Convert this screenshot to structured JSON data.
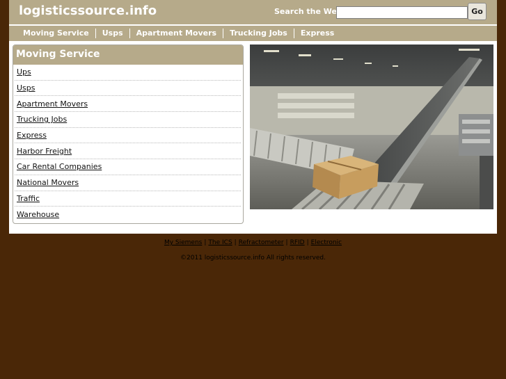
{
  "header": {
    "site_title": "logisticssource.info",
    "search_label": "Search the Web:",
    "search_value": "",
    "search_placeholder": "",
    "go_label": "Go"
  },
  "nav": {
    "items": [
      "Moving Service",
      "Usps",
      "Apartment Movers",
      "Trucking Jobs",
      "Express"
    ]
  },
  "sidebar": {
    "title": "Moving Service",
    "items": [
      "Ups",
      "Usps",
      "Apartment Movers",
      "Trucking Jobs",
      "Express",
      "Harbor Freight",
      "Car Rental Companies",
      "National Movers",
      "Traffic",
      "Warehouse"
    ]
  },
  "footer": {
    "links": [
      "My Siemens",
      "The ICS",
      "Refractometer",
      "RFID",
      "Electronic"
    ],
    "separator": "|",
    "copyright": "©2011 logisticssource.info All rights reserved."
  },
  "colors": {
    "background": "#4a2707",
    "header": "#b6aa8a",
    "content": "#ffffff"
  }
}
